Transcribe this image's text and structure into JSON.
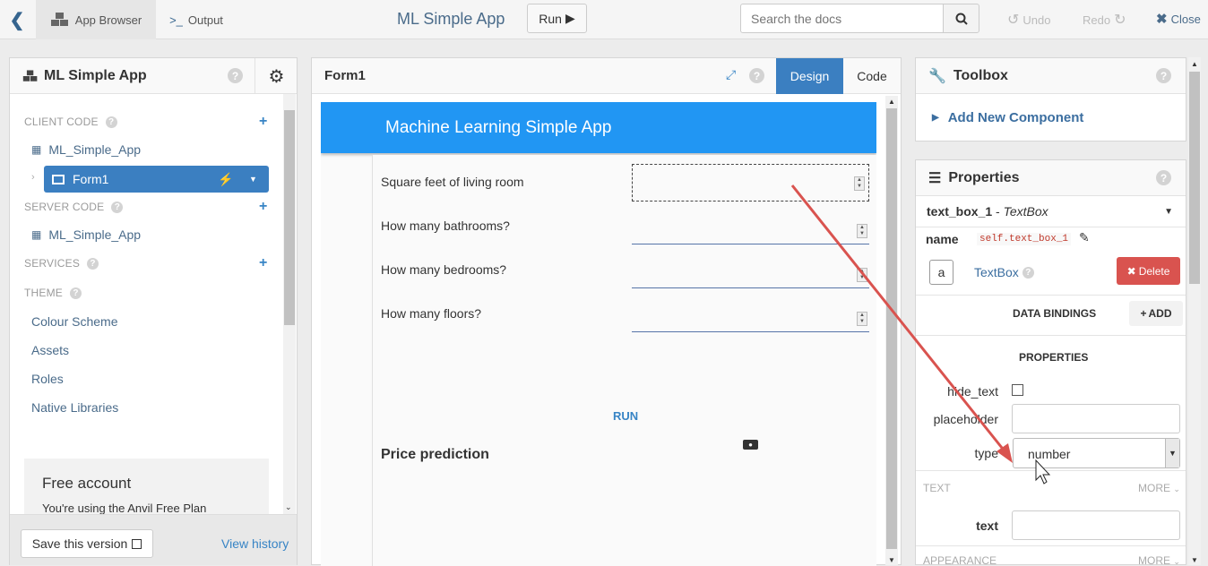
{
  "topbar": {
    "tab_app_browser": "App Browser",
    "tab_output": "Output",
    "app_title": "ML Simple App",
    "run_label": "Run",
    "search_placeholder": "Search the docs",
    "undo": "Undo",
    "redo": "Redo",
    "close": "Close"
  },
  "left": {
    "title": "ML Simple App",
    "client_code": "CLIENT CODE",
    "client_item": "ML_Simple_App",
    "form_item": "Form1",
    "server_code": "SERVER CODE",
    "server_item": "ML_Simple_App",
    "services": "SERVICES",
    "theme": "THEME",
    "theme_items": [
      "Colour Scheme",
      "Assets",
      "Roles",
      "Native Libraries"
    ],
    "free_title": "Free account",
    "free_text": "You're using the Anvil Free Plan",
    "save_label": "Save this version",
    "view_history": "View history"
  },
  "center": {
    "title": "Form1",
    "design_tab": "Design",
    "code_tab": "Code",
    "form_header": "Machine Learning Simple App",
    "fields": [
      "Square feet of living room",
      "How many bathrooms?",
      "How many bedrooms?",
      "How many floors?"
    ],
    "run_link": "RUN",
    "price_label": "Price prediction"
  },
  "toolbox": {
    "title": "Toolbox",
    "add_component": "Add New Component"
  },
  "properties": {
    "title": "Properties",
    "component": "text_box_1",
    "component_sep": " - ",
    "component_type": "TextBox",
    "name_label": "name",
    "name_value": "self.text_box_1",
    "icon_letter": "a",
    "textbox_link": "TextBox",
    "delete_label": "Delete",
    "data_bindings": "DATA BINDINGS",
    "add_label": "ADD",
    "properties_caption": "PROPERTIES",
    "hide_text_label": "hide_text",
    "placeholder_label": "placeholder",
    "type_label": "type",
    "type_value": "number",
    "text_section": "TEXT",
    "more": "MORE",
    "text_label": "text",
    "appearance_section": "APPEARANCE"
  },
  "colors": {
    "accent": "#2196f3",
    "design_tab": "#3b7fc1",
    "delete": "#d9534f",
    "arrow": "#d9534f"
  }
}
